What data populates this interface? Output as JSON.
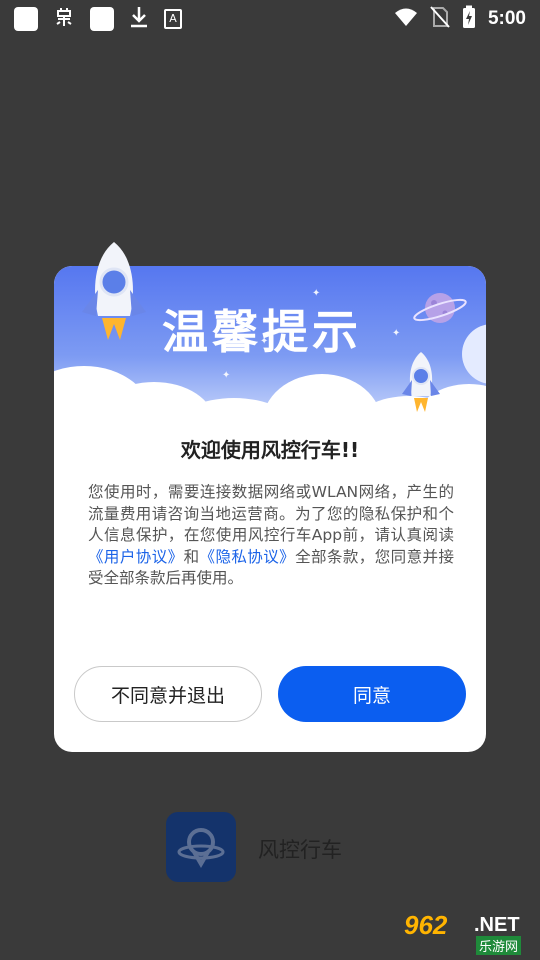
{
  "status_bar": {
    "time": "5:00",
    "icons": [
      "square-icon",
      "bug-icon",
      "square-icon",
      "download-icon",
      "a-icon",
      "wifi-icon",
      "no-sim-icon",
      "battery-charging-icon"
    ]
  },
  "dialog": {
    "header_title": "温馨提示",
    "heading": "欢迎使用风控行车!!",
    "body_prefix": "您使用时，需要连接数据网络或WLAN网络，产生的流量费用请咨询当地运营商。为了您的隐私保护和个人信息保护，在您使用风控行车App前，请认真阅读",
    "user_agreement_link": "《用户协议》",
    "and_text": "和",
    "privacy_link": "《隐私协议》",
    "body_suffix": "全部条款，您同意并接受全部条款后再使用。",
    "decline_label": "不同意并退出",
    "agree_label": "同意"
  },
  "app": {
    "name": "风控行车"
  },
  "watermark": {
    "number": "962",
    "suffix": ".NET",
    "subtitle": "乐游网"
  },
  "colors": {
    "accent": "#0b5ef0",
    "link": "#1b63e8",
    "header_gradient_top": "#5677f0",
    "backdrop": "#3a3a3a"
  }
}
